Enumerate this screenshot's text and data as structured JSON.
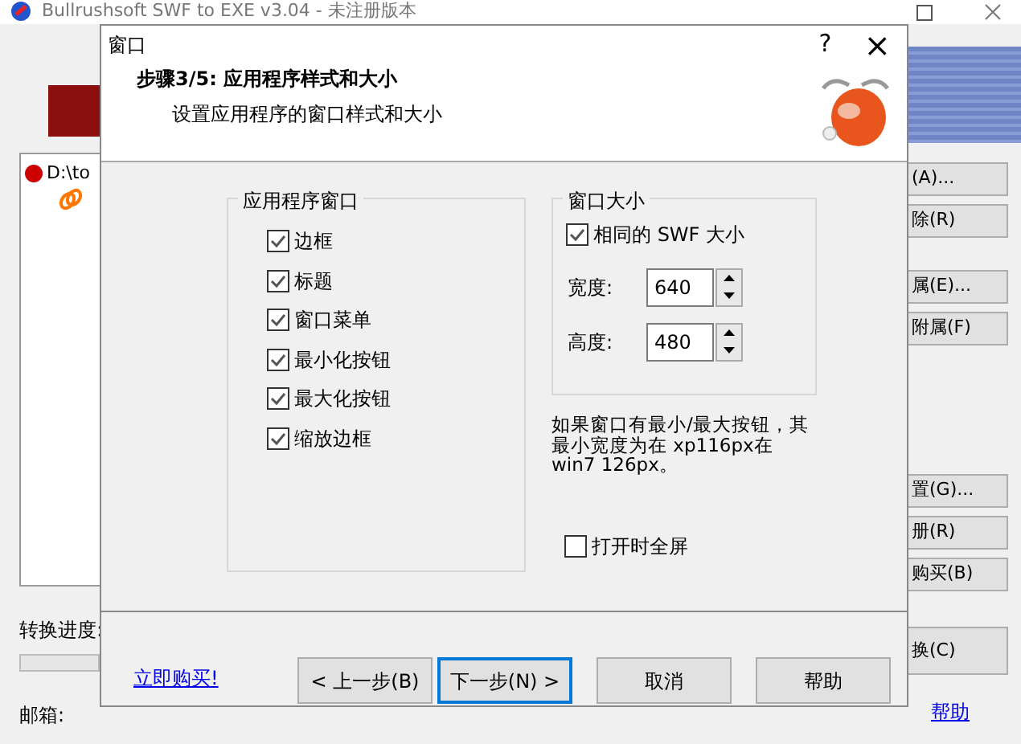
{
  "main_window": {
    "title": "Bullrushsoft SWF to EXE v3.04 - 未注册版本",
    "list_items": [
      {
        "text": "D:\\to"
      }
    ],
    "side_buttons": [
      "(A)...",
      "除(R)",
      "属(E)...",
      "附属(F)",
      "置(G)...",
      "册(R)",
      "购买(B)",
      "换(C)"
    ],
    "progress_label": "转换进度:",
    "progress": {
      "level": 0
    },
    "email_label": "邮箱:",
    "help_link": "帮助"
  },
  "dialog": {
    "title": "窗口",
    "help_glyph": "?",
    "close_glyph": "×",
    "header_title": "步骤3/5: 应用程序样式和大小",
    "header_subtitle": "设置应用程序的窗口样式和大小",
    "window_group": {
      "title": "应用程序窗口",
      "options": [
        {
          "label": "边框",
          "checked": true
        },
        {
          "label": "标题",
          "checked": true
        },
        {
          "label": "窗口菜单",
          "checked": true
        },
        {
          "label": "最小化按钮",
          "checked": true
        },
        {
          "label": "最大化按钮",
          "checked": true
        },
        {
          "label": "缩放边框",
          "checked": true
        }
      ]
    },
    "size_group": {
      "title": "窗口大小",
      "same_size": {
        "label": "相同的 SWF 大小",
        "checked": true
      },
      "fields": [
        {
          "label": "宽度:",
          "value": "640"
        },
        {
          "label": "高度:",
          "value": "480"
        }
      ]
    },
    "note": "如果窗口有最小/最大按钮，其最小宽度为在 xp116px在 win7 126px。",
    "fullscreen": {
      "label": "打开时全屏",
      "checked": false
    },
    "buy_link": "立即购买!",
    "buttons": [
      {
        "label": "< 上一步(B)",
        "selected": false
      },
      {
        "label": "下一步(N) >",
        "selected": true
      },
      {
        "label": "取消",
        "selected": false
      },
      {
        "label": "帮助",
        "selected": false
      }
    ]
  }
}
